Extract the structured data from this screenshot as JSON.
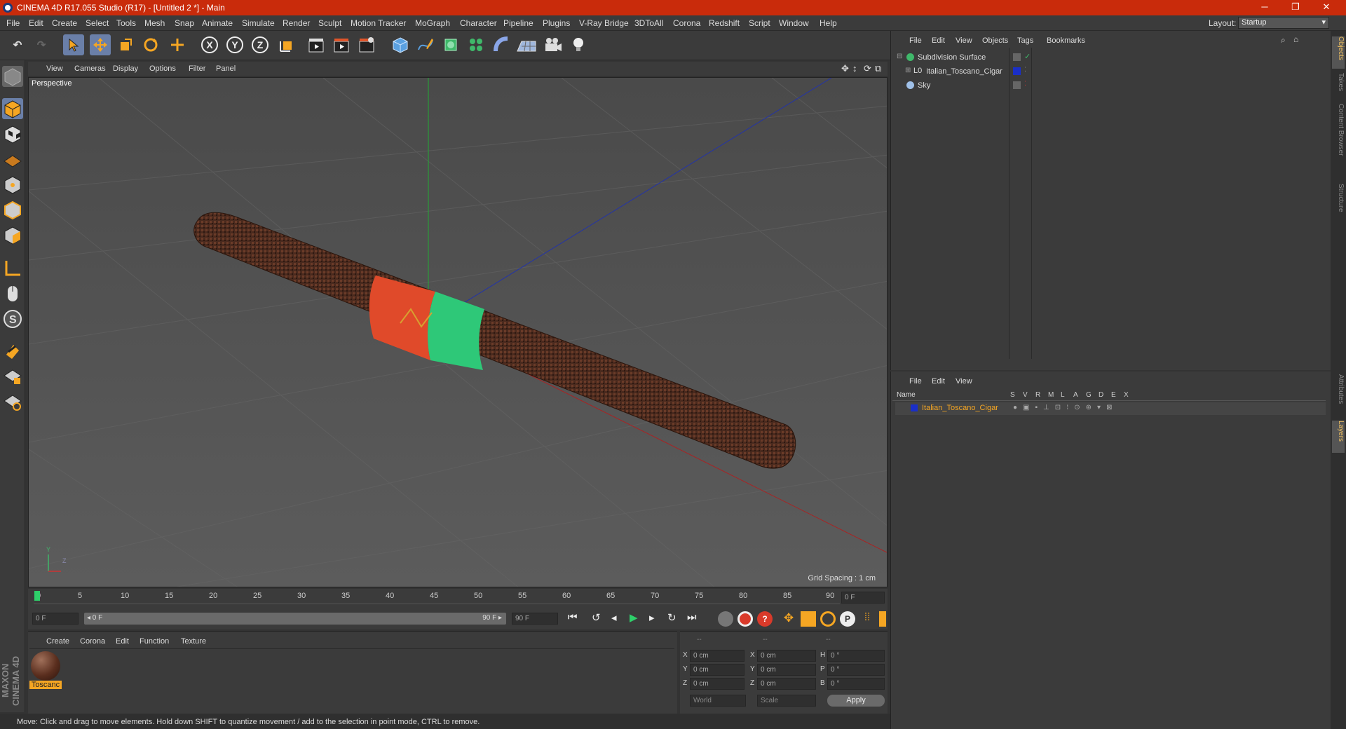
{
  "title_bar": {
    "title": "CINEMA 4D R17.055 Studio (R17) - [Untitled 2 *] - Main",
    "minimize": "─",
    "maximize": "❐",
    "close": "✕"
  },
  "menu": [
    "File",
    "Edit",
    "Create",
    "Select",
    "Tools",
    "Mesh",
    "Snap",
    "Animate",
    "Simulate",
    "Render",
    "Sculpt",
    "Motion Tracker",
    "MoGraph",
    "Character",
    "Pipeline",
    "Plugins",
    "V-Ray Bridge",
    "3DToAll",
    "Corona",
    "Redshift",
    "Script",
    "Window",
    "Help"
  ],
  "layout": {
    "label": "Layout:",
    "value": "Startup"
  },
  "toolbar_axes": [
    "X",
    "Y",
    "Z"
  ],
  "viewport": {
    "menu": [
      "View",
      "Cameras",
      "Display",
      "Options",
      "Filter",
      "Panel"
    ],
    "label": "Perspective",
    "grid_spacing": "Grid Spacing : 1 cm",
    "axis_y": "Y",
    "axis_z": "Z"
  },
  "timeline": {
    "ticks": [
      "0",
      "5",
      "10",
      "15",
      "20",
      "25",
      "30",
      "35",
      "40",
      "45",
      "50",
      "55",
      "60",
      "65",
      "70",
      "75",
      "80",
      "85",
      "90"
    ],
    "current_frame": "0 F",
    "start_field": "0 F",
    "range_start": "◂ 0 F",
    "range_end": "90 F ▸",
    "end_field": "90 F",
    "playhead_fraction": 0.0
  },
  "materials": {
    "menu": [
      "Create",
      "Corona",
      "Edit",
      "Function",
      "Texture"
    ],
    "items": [
      {
        "name": "Toscanc"
      }
    ]
  },
  "coordinates": {
    "headers": [
      "--",
      "--",
      "--"
    ],
    "rows": [
      {
        "a": "X",
        "v1": "0 cm",
        "b": "X",
        "v2": "0 cm",
        "c": "H",
        "v3": "0 °"
      },
      {
        "a": "Y",
        "v1": "0 cm",
        "b": "Y",
        "v2": "0 cm",
        "c": "P",
        "v3": "0 °"
      },
      {
        "a": "Z",
        "v1": "0 cm",
        "b": "Z",
        "v2": "0 cm",
        "c": "B",
        "v3": "0 °"
      }
    ],
    "mode1": "World",
    "mode2": "Scale",
    "apply": "Apply"
  },
  "status": "Move: Click and drag to move elements. Hold down SHIFT to quantize movement / add to the selection in point mode, CTRL to remove.",
  "objects_panel": {
    "menu": [
      "File",
      "Edit",
      "View",
      "Objects",
      "Tags",
      "Bookmarks"
    ],
    "items": [
      {
        "name": "Subdivision Surface"
      },
      {
        "name": "Italian_Toscano_Cigar"
      },
      {
        "name": "Sky"
      }
    ]
  },
  "layers_panel": {
    "menu": [
      "File",
      "Edit",
      "View"
    ],
    "name_header": "Name",
    "columns": [
      "S",
      "V",
      "R",
      "M",
      "L",
      "A",
      "G",
      "D",
      "E",
      "X"
    ],
    "items": [
      {
        "name": "Italian_Toscano_Cigar"
      }
    ]
  },
  "side_tabs": [
    "Objects",
    "Takes",
    "Content Browser",
    "Structure",
    "Attributes",
    "Layers"
  ],
  "brand": "MAXON CINEMA 4D"
}
